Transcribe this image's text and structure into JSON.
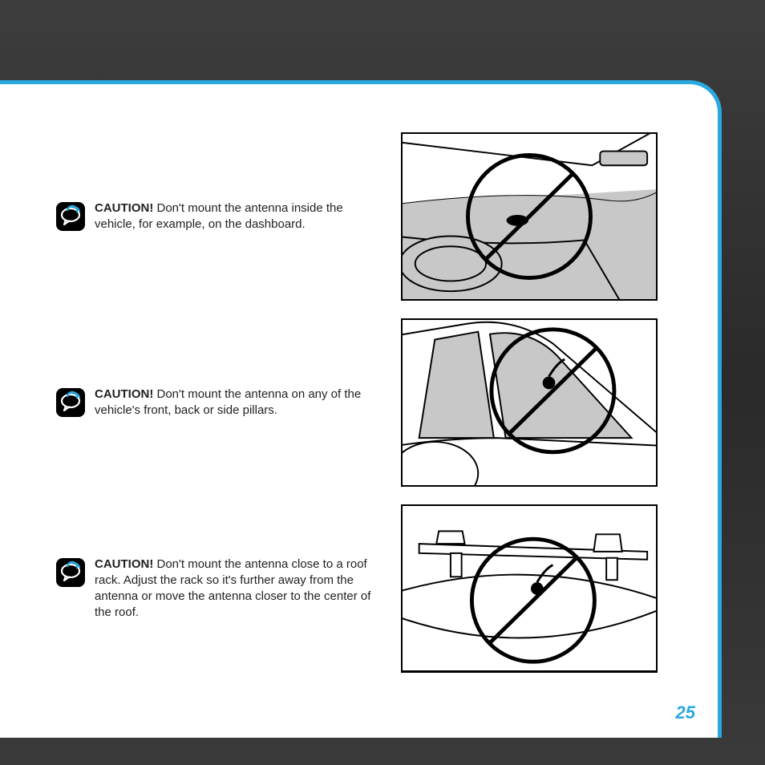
{
  "page_number": "25",
  "cautions": [
    {
      "label": "CAUTION!",
      "text": "Don't mount the antenna inside the vehicle, for example, on the dashboard."
    },
    {
      "label": "CAUTION!",
      "text": "Don't mount the antenna on any of the vehicle's front, back or side pillars."
    },
    {
      "label": "CAUTION!",
      "text": "Don't mount the antenna close to a roof rack. Adjust the rack so it's further away from the antenna or move the antenna closer to the center of the roof."
    }
  ]
}
